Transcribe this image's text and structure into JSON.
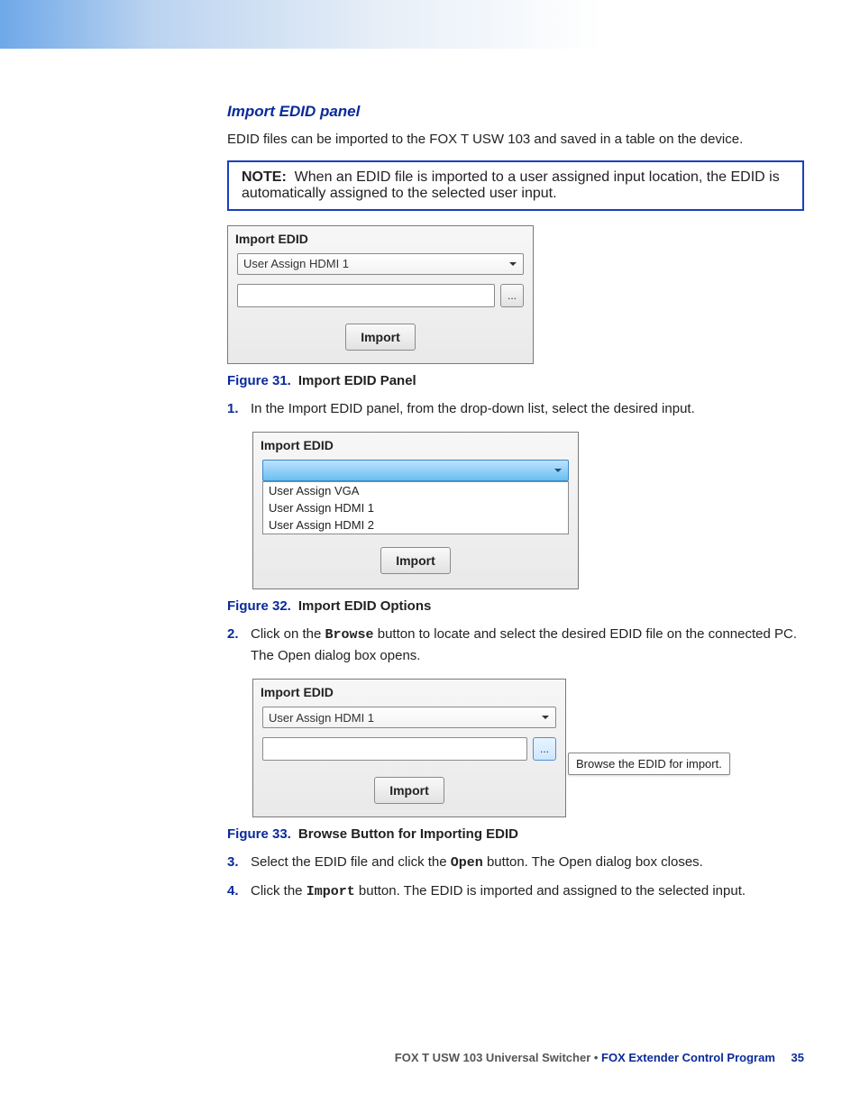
{
  "heading": "Import EDID panel",
  "intro": "EDID files can be imported to the FOX T USW 103 and saved in a table on the device.",
  "note": {
    "label": "NOTE:",
    "text": "When an EDID file is imported to a user assigned input location, the EDID is automatically assigned to the selected user input."
  },
  "panel": {
    "title": "Import EDID",
    "import_label": "Import",
    "browse_glyph": "..."
  },
  "fig31": {
    "dropdown_value": "User Assign HDMI 1",
    "caption_num": "Figure 31.",
    "caption_title": "Import EDID Panel"
  },
  "fig32": {
    "options": [
      "User Assign VGA",
      "User Assign HDMI 1",
      "User Assign HDMI 2"
    ],
    "caption_num": "Figure 32.",
    "caption_title": "Import EDID Options"
  },
  "fig33": {
    "dropdown_value": "User Assign HDMI 1",
    "tooltip": "Browse the EDID for import.",
    "caption_num": "Figure 33.",
    "caption_title": "Browse Button for Importing EDID"
  },
  "steps": [
    {
      "num": "1.",
      "text": "In the Import EDID panel, from the drop-down list, select the desired input."
    },
    {
      "num": "2.",
      "text_a": "Click on the",
      "mono": "Browse",
      "text_b": "button to locate and select the desired EDID file on the connected PC. The Open dialog box opens."
    },
    {
      "num": "3.",
      "text_a": "Select the EDID file and click the",
      "mono": "Open",
      "text_b": "button. The Open dialog box closes."
    },
    {
      "num": "4.",
      "text_a": "Click the",
      "mono": "Import",
      "text_b": "button. The EDID is imported and assigned to the selected input."
    }
  ],
  "footer": {
    "product": "FOX T USW 103 Universal Switcher • ",
    "section": "FOX Extender Control Program",
    "page": "35"
  }
}
